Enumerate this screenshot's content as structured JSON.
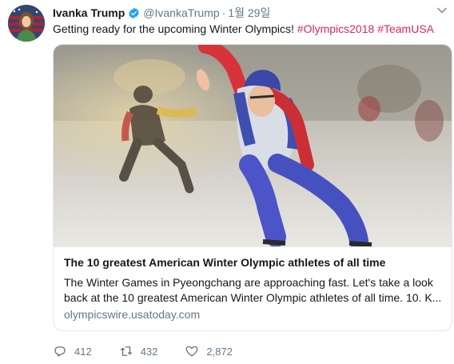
{
  "tweet": {
    "author_name": "Ivanka Trump",
    "handle": "@IvankaTrump",
    "separator": "·",
    "time": "1월 29일",
    "text": "Getting ready for the upcoming Winter Olympics! ",
    "hashtags": [
      "#Olympics2018",
      "#TeamUSA"
    ]
  },
  "card": {
    "title": "The 10 greatest American Winter Olympic athletes of all time",
    "description": "The Winter Games in Pyeongchang are approaching fast. Let's take a look back at the 10 greatest American Winter Olympic athletes of all time. 10. K...",
    "domain": "olympicswire.usatoday.com"
  },
  "actions": {
    "replies": "412",
    "retweets": "432",
    "likes": "2,872"
  },
  "colors": {
    "hashtag": "#e0245e",
    "verified": "#1da1f2",
    "muted": "#657786"
  },
  "icons": [
    "verified-badge-icon",
    "chevron-down-icon",
    "reply-icon",
    "retweet-icon",
    "like-icon"
  ]
}
